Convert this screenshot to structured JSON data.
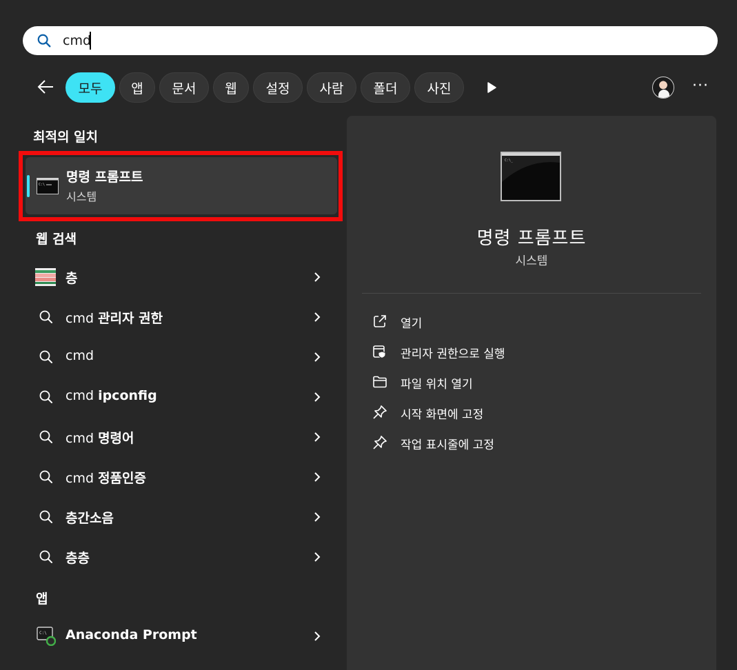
{
  "search": {
    "value": "cmd",
    "placeholder": ""
  },
  "filters": {
    "back_icon": "arrow-left-icon",
    "chips": [
      {
        "label": "모두",
        "active": true
      },
      {
        "label": "앱",
        "active": false
      },
      {
        "label": "문서",
        "active": false
      },
      {
        "label": "웹",
        "active": false
      },
      {
        "label": "설정",
        "active": false
      },
      {
        "label": "사람",
        "active": false
      },
      {
        "label": "폴더",
        "active": false
      },
      {
        "label": "사진",
        "active": false
      }
    ],
    "more_icon": "play-icon",
    "menu_label": "···"
  },
  "sections": {
    "best_match": "최적의 일치",
    "web_search": "웹 검색",
    "apps": "앱"
  },
  "best_match": {
    "title": "명령 프롬프트",
    "subtitle": "시스템",
    "icon": "command-prompt-icon"
  },
  "web_results": [
    {
      "prefix": "",
      "bold": "층",
      "icon": "layer-image-icon"
    },
    {
      "prefix": "cmd ",
      "bold": "관리자 권한",
      "icon": "search-icon"
    },
    {
      "prefix": "cmd",
      "bold": "",
      "icon": "search-icon"
    },
    {
      "prefix": "cmd ",
      "bold": "ipconfig",
      "icon": "search-icon"
    },
    {
      "prefix": "cmd ",
      "bold": "명령어",
      "icon": "search-icon"
    },
    {
      "prefix": "cmd ",
      "bold": "정품인증",
      "icon": "search-icon"
    },
    {
      "prefix": "",
      "bold": "층간소음",
      "icon": "search-icon"
    },
    {
      "prefix": "",
      "bold": "층층",
      "icon": "search-icon"
    }
  ],
  "apps": [
    {
      "label": "Anaconda Prompt",
      "icon": "anaconda-prompt-icon"
    }
  ],
  "detail": {
    "title": "명령 프롬프트",
    "subtitle": "시스템",
    "actions": [
      {
        "label": "열기",
        "icon": "open-external-icon"
      },
      {
        "label": "관리자 권한으로 실행",
        "icon": "shield-run-icon"
      },
      {
        "label": "파일 위치 열기",
        "icon": "folder-icon"
      },
      {
        "label": "시작 화면에 고정",
        "icon": "pin-icon"
      },
      {
        "label": "작업 표시줄에 고정",
        "icon": "pin-icon"
      }
    ]
  },
  "colors": {
    "accent": "#3ee2f4",
    "background": "#272727",
    "panel": "#333333",
    "highlight": "#f20c0c"
  }
}
